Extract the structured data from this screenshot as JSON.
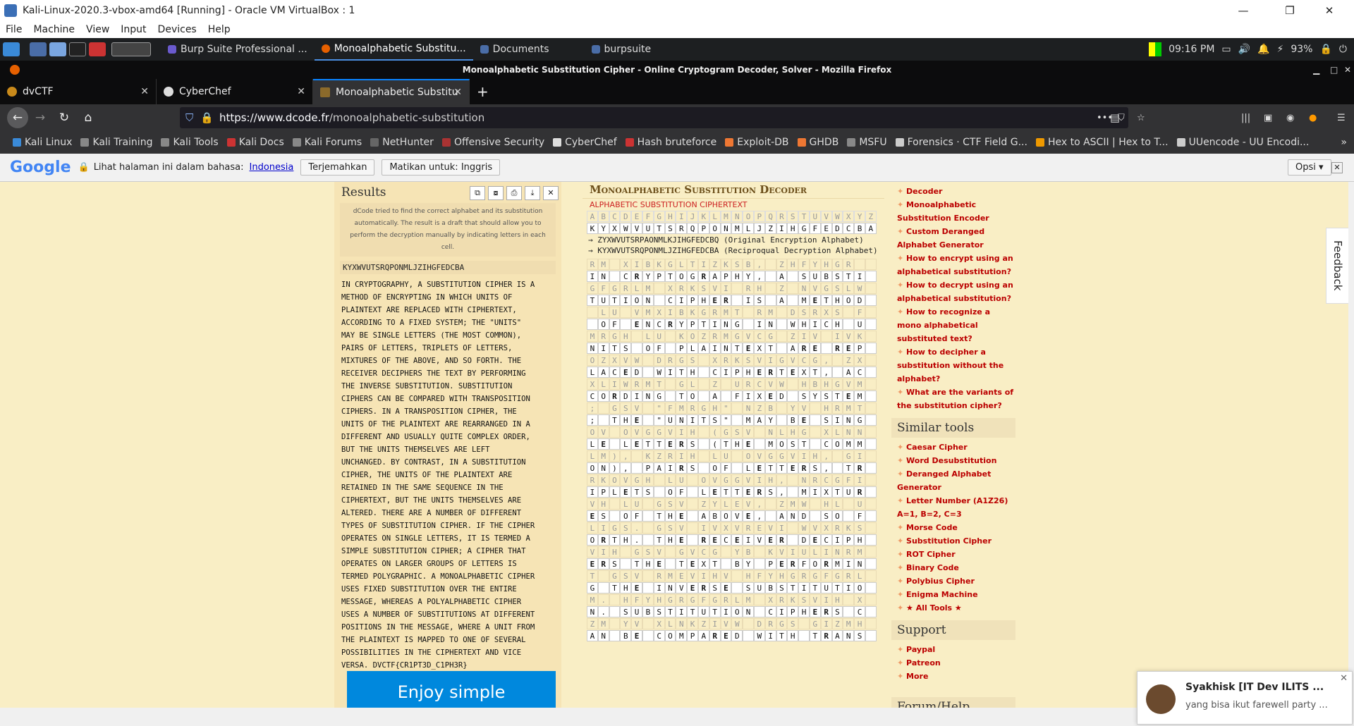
{
  "vbox": {
    "title": "Kali-Linux-2020.3-vbox-amd64 [Running] - Oracle VM VirtualBox : 1",
    "menu": [
      "File",
      "Machine",
      "View",
      "Input",
      "Devices",
      "Help"
    ],
    "min": "—",
    "max": "❐",
    "close": "✕"
  },
  "panel": {
    "tasks": [
      {
        "label": "Burp Suite Professional ...",
        "color": "#6a5acd"
      },
      {
        "label": "Monoalphabetic Substitu...",
        "color": "#e66000"
      },
      {
        "label": "Documents",
        "color": "#4a6da7"
      },
      {
        "label": "burpsuite",
        "color": "#4a6da7"
      }
    ],
    "clock": "09:16 PM",
    "battery": "93%"
  },
  "firefox": {
    "title": "Monoalphabetic Substitution Cipher - Online Cryptogram Decoder, Solver - Mozilla Firefox",
    "tabs": [
      {
        "label": "dvCTF",
        "color": "#c98a1b"
      },
      {
        "label": "CyberChef",
        "color": "#ddd"
      },
      {
        "label": "Monoalphabetic Substitu",
        "color": "#8b6a2b"
      }
    ],
    "url_host": "https://www.dcode.fr",
    "url_path": "/monoalphabetic-substitution",
    "bookmarks": [
      "Kali Linux",
      "Kali Training",
      "Kali Tools",
      "Kali Docs",
      "Kali Forums",
      "NetHunter",
      "Offensive Security",
      "CyberChef",
      "Hash bruteforce",
      "Exploit-DB",
      "GHDB",
      "MSFU",
      "Forensics · CTF Field G...",
      "Hex to ASCII | Hex to T...",
      "UUencode - UU Encodi..."
    ]
  },
  "gtranslate": {
    "logo": "Google",
    "prompt": "Lihat halaman ini dalam bahasa:",
    "lang": "Indonesia",
    "translate": "Terjemahkan",
    "off": "Matikan untuk: Inggris",
    "options": "Opsi ▾",
    "close": "✕"
  },
  "results": {
    "title": "Results",
    "note": "dCode tried to find the correct alphabet and its substitution automatically. The result is a draft that should allow you to perform the decryption manually by indicating letters in each cell.",
    "key": "KYXWVUTSRQPONMLJZIHGFEDCBA",
    "text": "IN CRYPTOGRAPHY, A SUBSTITUTION CIPHER IS A\nMETHOD OF ENCRYPTING IN WHICH UNITS OF\nPLAINTEXT ARE REPLACED WITH CIPHERTEXT,\nACCORDING TO A FIXED SYSTEM; THE \"UNITS\"\nMAY BE SINGLE LETTERS (THE MOST COMMON),\nPAIRS OF LETTERS, TRIPLETS OF LETTERS,\nMIXTURES OF THE ABOVE, AND SO FORTH. THE\nRECEIVER DECIPHERS THE TEXT BY PERFORMING\nTHE INVERSE SUBSTITUTION. SUBSTITUTION\nCIPHERS CAN BE COMPARED WITH TRANSPOSITION\nCIPHERS. IN A TRANSPOSITION CIPHER, THE\nUNITS OF THE PLAINTEXT ARE REARRANGED IN A\nDIFFERENT AND USUALLY QUITE COMPLEX ORDER,\nBUT THE UNITS THEMSELVES ARE LEFT\nUNCHANGED. BY CONTRAST, IN A SUBSTITUTION\nCIPHER, THE UNITS OF THE PLAINTEXT ARE\nRETAINED IN THE SAME SEQUENCE IN THE\nCIPHERTEXT, BUT THE UNITS THEMSELVES ARE\nALTERED. THERE ARE A NUMBER OF DIFFERENT\nTYPES OF SUBSTITUTION CIPHER. IF THE CIPHER\nOPERATES ON SINGLE LETTERS, IT IS TERMED A\nSIMPLE SUBSTITUTION CIPHER; A CIPHER THAT\nOPERATES ON LARGER GROUPS OF LETTERS IS\nTERMED POLYGRAPHIC. A MONOALPHABETIC CIPHER\nUSES FIXED SUBSTITUTION OVER THE ENTIRE\nMESSAGE, WHEREAS A POLYALPHABETIC CIPHER\nUSES A NUMBER OF SUBSTITUTIONS AT DIFFERENT\nPOSITIONS IN THE MESSAGE, WHERE A UNIT FROM\nTHE PLAINTEXT IS MAPPED TO ONE OF SEVERAL\nPOSSIBILITIES IN THE CIPHERTEXT AND VICE\nVERSA. DVCTF{CR1PT3D_C1PH3R}",
    "ad": "Enjoy simple"
  },
  "decoder": {
    "title": "Monoalphabetic Substitution Decoder",
    "sub": "ALPHABETIC SUBSTITUTION CIPHERTEXT",
    "alpha": "ABCDEFGHIJKLMNOPQRSTUVWXYZ",
    "keyrow": "KYXWVUTSRQPONMLJZIHGFEDCBA",
    "enc": "→ ZYXWVUTSRPAONMLKJIHGFEDCBQ (Original Encryption Alphabet)",
    "dec": "→ KYXWVUTSRQPONMLJZIHGFEDCBA (Reciproqual Decryption Alphabet)",
    "rows": [
      [
        "RM XIBKGLTIZKSB, ZHFYHGR",
        "IN CRYPTOGRAPHY, A SUBSTI"
      ],
      [
        "GFGRLM XRKSVI RH Z NVGSLW",
        "TUTION CIPHER IS A METHOD"
      ],
      [
        " LU VMXIBKGRMT RM DSRXS F",
        " OF ENCRYPTING IN WHICH U"
      ],
      [
        "MRGH LU KOZRMGVCG ZIV IVK",
        "NITS OF PLAINTEXT ARE REP"
      ],
      [
        "OZXVW DRGS XRKSVIGVCG, ZX",
        "LACED WITH CIPHERTEXT, AC"
      ],
      [
        "XLIWRMT GL Z URCVW HBHGVM",
        "CORDING TO A FIXED SYSTEM"
      ],
      [
        "; GSV \"FMRGH\" NZB YV HRMT",
        "; THE \"UNITS\" MAY BE SING"
      ],
      [
        "OV OVGGVIH (GSV NLHG XLNN",
        "LE LETTERS (THE MOST COMM"
      ],
      [
        "LM), KZRIH LU OVGGVIH, GI",
        "ON), PAIRS OF LETTERS, TR"
      ],
      [
        "RKOVGH LU OVGGVIH, NRCGFI",
        "IPLETS OF LETTERS, MIXTUR"
      ],
      [
        "VH LU GSV ZYLEV, ZMW HL U",
        "ES OF THE ABOVE, AND SO F"
      ],
      [
        "LIGS. GSV IVXVREVI WVXRKS",
        "ORTH. THE RECEIVER DECIPH"
      ],
      [
        "VIH GSV GVCG YB KVIULINRM",
        "ERS THE TEXT BY PERFORMIN"
      ],
      [
        "T GSV RMEVIHV HFYHGRGFGRL",
        "G THE INVERSE SUBSTITUTIO"
      ],
      [
        "M. HFYHGRGFGRLM XRKSVIH X",
        "N. SUBSTITUTION CIPHERS C"
      ],
      [
        "ZM YV XLNKZIVW DRGS GIZMH",
        "AN BE COMPARED WITH TRANS"
      ]
    ]
  },
  "side": {
    "top_items": [
      "Decoder",
      "Monoalphabetic Substitution Encoder",
      "Custom Deranged Alphabet Generator",
      "How to encrypt using an alphabetical substitution?",
      "How to decrypt using an alphabetical substitution?",
      "How to recognize a mono alphabetical substituted text?",
      "How to decipher a substitution without the alphabet?",
      "What are the variants of the substitution cipher?"
    ],
    "similar_title": "Similar tools",
    "similar": [
      "Caesar Cipher",
      "Word Desubstitution",
      "Deranged Alphabet Generator",
      "Letter Number (A1Z26) A=1, B=2, C=3",
      "Morse Code",
      "Substitution Cipher",
      "ROT Cipher",
      "Binary Code",
      "Polybius Cipher",
      "Enigma Machine",
      "★ All Tools ★"
    ],
    "support_title": "Support",
    "support": [
      "Paypal",
      "Patreon",
      "More"
    ],
    "forum_title": "Forum/Help"
  },
  "feedback": "Feedback",
  "notification": {
    "title": "Syakhisk [IT Dev ILITS ...",
    "message": "yang bisa ikut farewell party ..."
  }
}
